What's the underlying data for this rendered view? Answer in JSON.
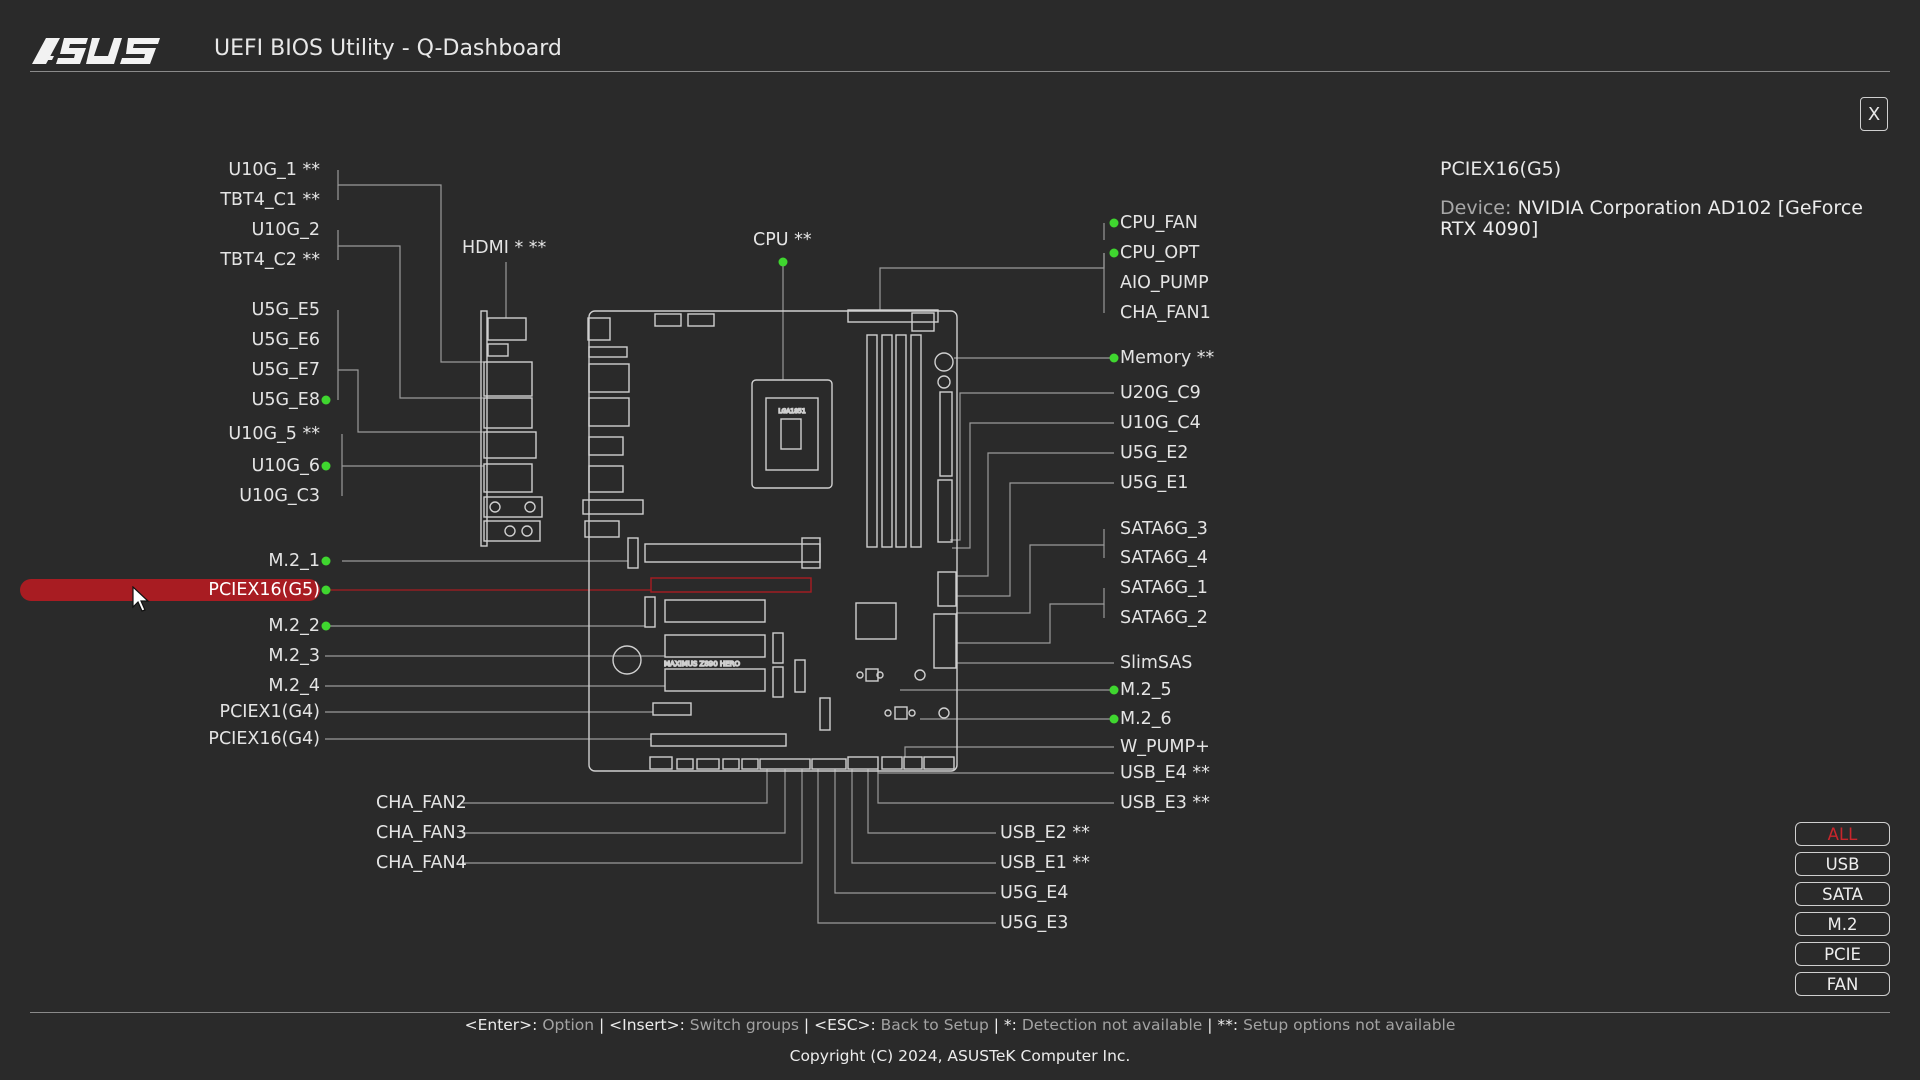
{
  "header": {
    "logo": "ASUS",
    "title": "UEFI BIOS Utility - Q-Dashboard",
    "close_label": "X"
  },
  "left_labels": [
    {
      "text": "U10G_1 **",
      "status": "none"
    },
    {
      "text": "TBT4_C1 **",
      "status": "none"
    },
    {
      "text": "U10G_2",
      "status": "none"
    },
    {
      "text": "TBT4_C2 **",
      "status": "none"
    },
    {
      "text": "U5G_E5",
      "status": "none"
    },
    {
      "text": "U5G_E6",
      "status": "none"
    },
    {
      "text": "U5G_E7",
      "status": "none"
    },
    {
      "text": "U5G_E8",
      "status": "connected"
    },
    {
      "text": "U10G_5 **",
      "status": "none"
    },
    {
      "text": "U10G_6",
      "status": "connected"
    },
    {
      "text": "U10G_C3",
      "status": "none"
    },
    {
      "text": "M.2_1",
      "status": "connected"
    },
    {
      "text": "PCIEX16(G5)",
      "status": "connected",
      "selected": true
    },
    {
      "text": "M.2_2",
      "status": "connected"
    },
    {
      "text": "M.2_3",
      "status": "none"
    },
    {
      "text": "M.2_4",
      "status": "none"
    },
    {
      "text": "PCIEX1(G4)",
      "status": "none"
    },
    {
      "text": "PCIEX16(G4)",
      "status": "none"
    }
  ],
  "top_labels": [
    {
      "text": "HDMI * **",
      "status": "none"
    },
    {
      "text": "CPU **",
      "status": "connected"
    }
  ],
  "right_labels": [
    {
      "text": "CPU_FAN",
      "status": "connected"
    },
    {
      "text": "CPU_OPT",
      "status": "connected"
    },
    {
      "text": "AIO_PUMP",
      "status": "none"
    },
    {
      "text": "CHA_FAN1",
      "status": "none"
    },
    {
      "text": "Memory **",
      "status": "connected"
    },
    {
      "text": "U20G_C9",
      "status": "none"
    },
    {
      "text": "U10G_C4",
      "status": "none"
    },
    {
      "text": "U5G_E2",
      "status": "none"
    },
    {
      "text": "U5G_E1",
      "status": "none"
    },
    {
      "text": "SATA6G_3",
      "status": "none"
    },
    {
      "text": "SATA6G_4",
      "status": "none"
    },
    {
      "text": "SATA6G_1",
      "status": "none"
    },
    {
      "text": "SATA6G_2",
      "status": "none"
    },
    {
      "text": "SlimSAS",
      "status": "none"
    },
    {
      "text": "M.2_5",
      "status": "connected"
    },
    {
      "text": "M.2_6",
      "status": "connected"
    },
    {
      "text": "W_PUMP+",
      "status": "none"
    },
    {
      "text": "USB_E4 **",
      "status": "none"
    },
    {
      "text": "USB_E3 **",
      "status": "none"
    }
  ],
  "bottom_labels": [
    {
      "text": "CHA_FAN2",
      "status": "none"
    },
    {
      "text": "CHA_FAN3",
      "status": "none"
    },
    {
      "text": "CHA_FAN4",
      "status": "none"
    },
    {
      "text": "USB_E2 **",
      "status": "none"
    },
    {
      "text": "USB_E1 **",
      "status": "none"
    },
    {
      "text": "U5G_E4",
      "status": "none"
    },
    {
      "text": "U5G_E3",
      "status": "none"
    }
  ],
  "board_text": {
    "socket_label": "LGA1851",
    "model_label": "MAXIMUS Z890 HERO"
  },
  "info": {
    "title": "PCIEX16(G5)",
    "device_key": "Device:",
    "device_value": "NVIDIA Corporation AD102 [GeForce RTX 4090]"
  },
  "filters": [
    {
      "label": "ALL",
      "active": true
    },
    {
      "label": "USB",
      "active": false
    },
    {
      "label": "SATA",
      "active": false
    },
    {
      "label": "M.2",
      "active": false
    },
    {
      "label": "PCIE",
      "active": false
    },
    {
      "label": "FAN",
      "active": false
    }
  ],
  "footer": {
    "help": [
      {
        "key": "<Enter>",
        "desc": "Option"
      },
      {
        "key": "<Insert>",
        "desc": "Switch groups"
      },
      {
        "key": "<ESC>",
        "desc": "Back to Setup"
      },
      {
        "key": "*",
        "desc": "Detection not available"
      },
      {
        "key": "**",
        "desc": "Setup options not available"
      }
    ],
    "copyright": "Copyright (C) 2024, ASUSTeK Computer Inc."
  },
  "colors": {
    "background": "#2a2a2a",
    "connected_dot": "#3fd62f",
    "selected": "#a81c22",
    "line": "#9a9a9a"
  }
}
